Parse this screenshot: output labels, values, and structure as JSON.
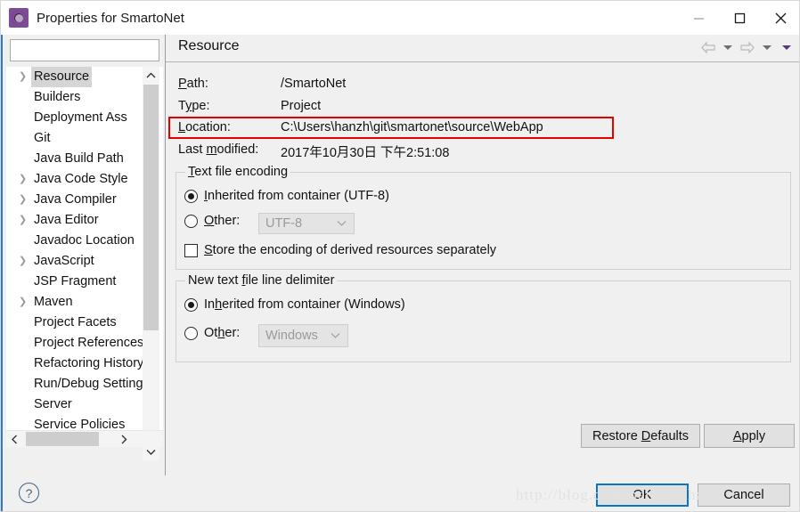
{
  "window": {
    "title": "Properties for SmartoNet",
    "app_icon": "gear-icon",
    "minimize": "minimize-icon",
    "maximize": "maximize-icon",
    "close": "close-icon"
  },
  "sidebar": {
    "filter_value": "",
    "filter_placeholder": "",
    "items": [
      {
        "label": "Resource",
        "expandable": true,
        "selected": true
      },
      {
        "label": "Builders",
        "expandable": false,
        "selected": false
      },
      {
        "label": "Deployment Ass",
        "expandable": false,
        "selected": false
      },
      {
        "label": "Git",
        "expandable": false,
        "selected": false
      },
      {
        "label": "Java Build Path",
        "expandable": false,
        "selected": false
      },
      {
        "label": "Java Code Style",
        "expandable": true,
        "selected": false
      },
      {
        "label": "Java Compiler",
        "expandable": true,
        "selected": false
      },
      {
        "label": "Java Editor",
        "expandable": true,
        "selected": false
      },
      {
        "label": "Javadoc Location",
        "expandable": false,
        "selected": false
      },
      {
        "label": "JavaScript",
        "expandable": true,
        "selected": false
      },
      {
        "label": "JSP Fragment",
        "expandable": false,
        "selected": false
      },
      {
        "label": "Maven",
        "expandable": true,
        "selected": false
      },
      {
        "label": "Project Facets",
        "expandable": false,
        "selected": false
      },
      {
        "label": "Project References",
        "expandable": false,
        "selected": false
      },
      {
        "label": "Refactoring History",
        "expandable": false,
        "selected": false
      },
      {
        "label": "Run/Debug Settings",
        "expandable": false,
        "selected": false
      },
      {
        "label": "Server",
        "expandable": false,
        "selected": false
      },
      {
        "label": "Service Policies",
        "expandable": false,
        "selected": false
      }
    ],
    "scroll_up": "chevron-up-icon",
    "scroll_down": "chevron-down-icon",
    "scroll_left": "chevron-left-icon",
    "scroll_right": "chevron-right-icon"
  },
  "page": {
    "title": "Resource",
    "nav": {
      "back": "back-arrow-icon",
      "back_menu": "chevron-down-icon",
      "forward": "forward-arrow-icon",
      "forward_menu": "chevron-down-icon",
      "view_menu": "view-menu-icon"
    },
    "fields": [
      {
        "label": "Path:",
        "accel": "P",
        "value": "/SmartoNet"
      },
      {
        "label": "Type:",
        "accel": "y",
        "value": "Project"
      },
      {
        "label": "Location:",
        "accel": "L",
        "value": "C:\\Users\\hanzh\\git\\smartonet\\source\\WebApp"
      },
      {
        "label": "Last modified:",
        "accel": "m",
        "value": "2017年10月30日 下午2:51:08"
      }
    ],
    "highlight_color": "#e60000",
    "encoding_group": {
      "title": "Text file encoding",
      "title_accel": "T",
      "inherited_label": "Inherited from container (UTF-8)",
      "inherited_accel": "I",
      "inherited_selected": true,
      "other_label": "Other:",
      "other_accel": "O",
      "other_selected": false,
      "other_value": "UTF-8",
      "store_label": "Store the encoding of derived resources separately",
      "store_accel": "S",
      "store_checked": false
    },
    "delimiter_group": {
      "title": "New text file line delimiter",
      "title_accel": "f",
      "inherited_label": "Inherited from container (Windows)",
      "inherited_accel": "h",
      "inherited_selected": true,
      "other_label": "Other:",
      "other_accel": "h",
      "other_selected": false,
      "other_value": "Windows"
    },
    "restore_defaults": {
      "label": "Restore Defaults",
      "accel": "D"
    },
    "apply": {
      "label": "Apply",
      "accel": "A"
    }
  },
  "footer": {
    "help": "?",
    "ok": "OK",
    "cancel": "Cancel",
    "watermark": "http://blog.csdn.net/zhaohan_"
  }
}
